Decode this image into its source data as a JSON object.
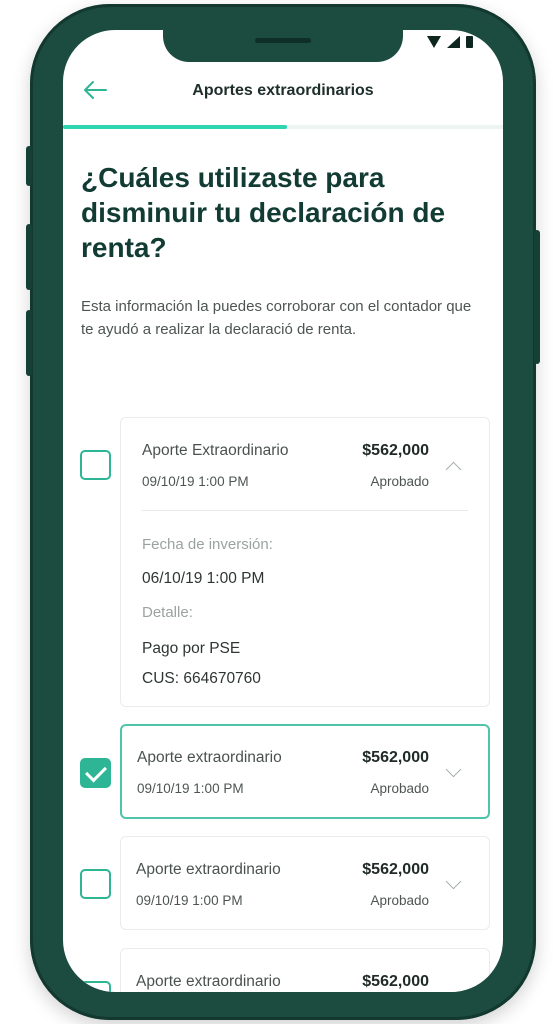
{
  "header": {
    "title": "Aportes extraordinarios",
    "back_icon": "arrow-left-icon"
  },
  "progress": {
    "fraction": 0.51
  },
  "headline": "¿Cuáles utilizaste para disminuir tu declaración de renta?",
  "description": "Esta información la puedes corroborar con el contador que te ayudó a realizar la declaració de renta.",
  "items": [
    {
      "title": "Aporte Extraordinario",
      "amount": "$562,000",
      "date": "09/10/19 1:00 PM",
      "status": "Aprobado",
      "checked": false,
      "expanded": true,
      "details": {
        "investment_date_label": "Fecha de inversión:",
        "investment_date": "06/10/19 1:00 PM",
        "detail_label": "Detalle:",
        "detail_line1": "Pago por PSE",
        "detail_line2": "CUS: 664670760"
      }
    },
    {
      "title": "Aporte extraordinario",
      "amount": "$562,000",
      "date": "09/10/19 1:00 PM",
      "status": "Aprobado",
      "checked": true,
      "expanded": false
    },
    {
      "title": "Aporte extraordinario",
      "amount": "$562,000",
      "date": "09/10/19 1:00 PM",
      "status": "Aprobado",
      "checked": false,
      "expanded": false
    },
    {
      "title": "Aporte extraordinario",
      "amount": "$562,000",
      "checked": false,
      "expanded": false
    }
  ],
  "colors": {
    "accent": "#2eb596",
    "progress": "#2fd4b0",
    "heading": "#123c33",
    "device_frame": "#1c4b40"
  }
}
